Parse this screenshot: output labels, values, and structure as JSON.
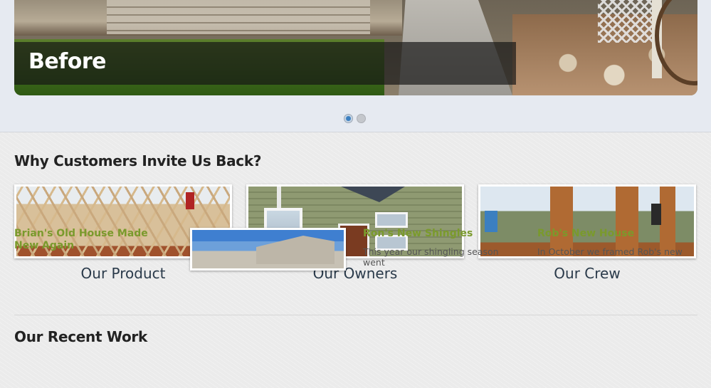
{
  "slider": {
    "caption": "Before",
    "dots": [
      {
        "state": "active"
      },
      {
        "state": "inactive"
      }
    ]
  },
  "why_section": {
    "heading": "Why Customers Invite Us Back?",
    "items": [
      {
        "label": "Our Product",
        "image": "roof-framing-photo"
      },
      {
        "label": "Our Owners",
        "image": "house-exterior-photo"
      },
      {
        "label": "Our Crew",
        "image": "crew-framing-photo"
      }
    ]
  },
  "recent_work": {
    "heading": "Our Recent Work",
    "entries": [
      {
        "title": "Brian's Old House Made New Again",
        "excerpt": ""
      },
      {
        "title": "Ron's New Shingles",
        "excerpt": "This year our shingling season went"
      },
      {
        "title": "Rob's New House",
        "excerpt": "In October we framed Rob's new"
      }
    ]
  },
  "colors": {
    "accent_green": "#7a9a2c",
    "heading": "#222222",
    "caption_text": "#2a3a4a",
    "active_dot": "#3b7fc0"
  }
}
